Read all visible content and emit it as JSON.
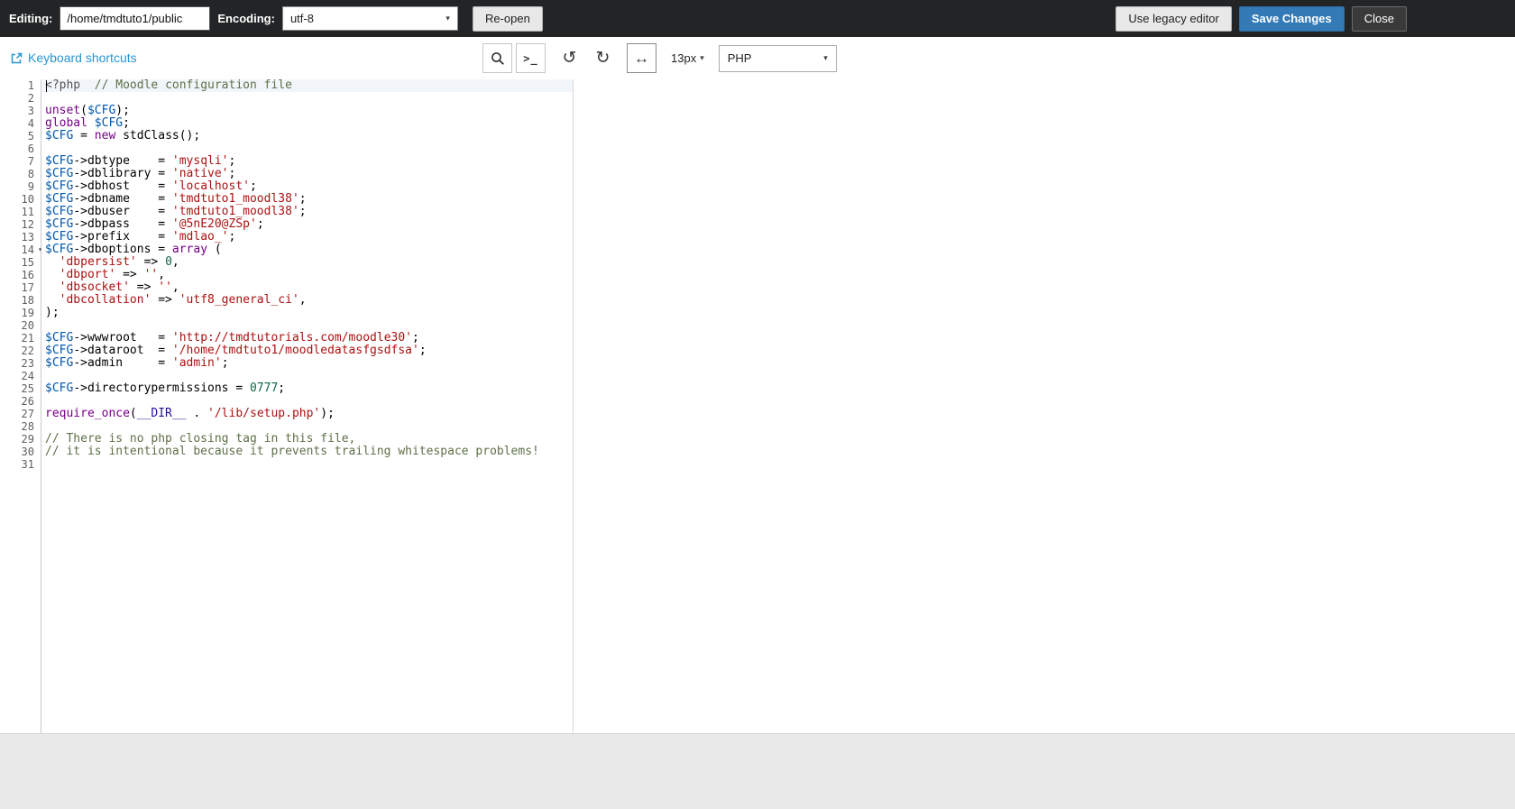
{
  "topbar": {
    "editing_label": "Editing:",
    "file_path": "/home/tmdtuto1/public",
    "encoding_label": "Encoding:",
    "encoding_value": "utf-8",
    "reopen_label": "Re-open",
    "legacy_editor_label": "Use legacy editor",
    "save_changes_label": "Save Changes",
    "close_label": "Close"
  },
  "toolbar": {
    "keyboard_shortcuts_label": "Keyboard shortcuts",
    "font_size_value": "13px",
    "language_value": "PHP"
  },
  "icons": {
    "external_link": "box-with-arrow",
    "search": "magnifier",
    "terminal_prompt": ">_",
    "undo": "↺",
    "redo": "↻",
    "word_wrap": "↔",
    "dropdown_arrow": "▾",
    "fold_arrow": "▾"
  },
  "editor": {
    "active_line": 1,
    "fold_line": 14,
    "line_count": 31,
    "lines": [
      [
        [
          "m",
          "<?php"
        ],
        [
          "p",
          "  "
        ],
        [
          "c",
          "// Moodle configuration file"
        ]
      ],
      [],
      [
        [
          "k",
          "unset"
        ],
        [
          "p",
          "("
        ],
        [
          "v",
          "$CFG"
        ],
        [
          "p",
          ");"
        ]
      ],
      [
        [
          "k",
          "global"
        ],
        [
          "p",
          " "
        ],
        [
          "v",
          "$CFG"
        ],
        [
          "p",
          ";"
        ]
      ],
      [
        [
          "v",
          "$CFG"
        ],
        [
          "p",
          " = "
        ],
        [
          "k",
          "new"
        ],
        [
          "p",
          " stdClass();"
        ]
      ],
      [],
      [
        [
          "v",
          "$CFG"
        ],
        [
          "p",
          "->dbtype    = "
        ],
        [
          "s",
          "'mysqli'"
        ],
        [
          "p",
          ";"
        ]
      ],
      [
        [
          "v",
          "$CFG"
        ],
        [
          "p",
          "->dblibrary = "
        ],
        [
          "s",
          "'native'"
        ],
        [
          "p",
          ";"
        ]
      ],
      [
        [
          "v",
          "$CFG"
        ],
        [
          "p",
          "->dbhost    = "
        ],
        [
          "s",
          "'localhost'"
        ],
        [
          "p",
          ";"
        ]
      ],
      [
        [
          "v",
          "$CFG"
        ],
        [
          "p",
          "->dbname    = "
        ],
        [
          "s",
          "'tmdtuto1_moodl38'"
        ],
        [
          "p",
          ";"
        ]
      ],
      [
        [
          "v",
          "$CFG"
        ],
        [
          "p",
          "->dbuser    = "
        ],
        [
          "s",
          "'tmdtuto1_moodl38'"
        ],
        [
          "p",
          ";"
        ]
      ],
      [
        [
          "v",
          "$CFG"
        ],
        [
          "p",
          "->dbpass    = "
        ],
        [
          "s",
          "'@5nE20@ZSp'"
        ],
        [
          "p",
          ";"
        ]
      ],
      [
        [
          "v",
          "$CFG"
        ],
        [
          "p",
          "->prefix    = "
        ],
        [
          "s",
          "'mdlao_'"
        ],
        [
          "p",
          ";"
        ]
      ],
      [
        [
          "v",
          "$CFG"
        ],
        [
          "p",
          "->dboptions = "
        ],
        [
          "k",
          "array"
        ],
        [
          "p",
          " ("
        ]
      ],
      [
        [
          "p",
          "  "
        ],
        [
          "s",
          "'dbpersist'"
        ],
        [
          "p",
          " => "
        ],
        [
          "n",
          "0"
        ],
        [
          "p",
          ","
        ]
      ],
      [
        [
          "p",
          "  "
        ],
        [
          "s",
          "'dbport'"
        ],
        [
          "p",
          " => "
        ],
        [
          "s",
          "''"
        ],
        [
          "p",
          ","
        ]
      ],
      [
        [
          "p",
          "  "
        ],
        [
          "s",
          "'dbsocket'"
        ],
        [
          "p",
          " => "
        ],
        [
          "s",
          "''"
        ],
        [
          "p",
          ","
        ]
      ],
      [
        [
          "p",
          "  "
        ],
        [
          "s",
          "'dbcollation'"
        ],
        [
          "p",
          " => "
        ],
        [
          "s",
          "'utf8_general_ci'"
        ],
        [
          "p",
          ","
        ]
      ],
      [
        [
          "p",
          ");"
        ]
      ],
      [],
      [
        [
          "v",
          "$CFG"
        ],
        [
          "p",
          "->wwwroot   = "
        ],
        [
          "s",
          "'http://tmdtutorials.com/moodle30'"
        ],
        [
          "p",
          ";"
        ]
      ],
      [
        [
          "v",
          "$CFG"
        ],
        [
          "p",
          "->dataroot  = "
        ],
        [
          "s",
          "'/home/tmdtuto1/moodledatasfgsdfsa'"
        ],
        [
          "p",
          ";"
        ]
      ],
      [
        [
          "v",
          "$CFG"
        ],
        [
          "p",
          "->admin     = "
        ],
        [
          "s",
          "'admin'"
        ],
        [
          "p",
          ";"
        ]
      ],
      [],
      [
        [
          "v",
          "$CFG"
        ],
        [
          "p",
          "->directorypermissions = "
        ],
        [
          "n",
          "0777"
        ],
        [
          "p",
          ";"
        ]
      ],
      [],
      [
        [
          "k",
          "require_once"
        ],
        [
          "p",
          "("
        ],
        [
          "a",
          "__DIR__"
        ],
        [
          "p",
          " . "
        ],
        [
          "s",
          "'/lib/setup.php'"
        ],
        [
          "p",
          ");"
        ]
      ],
      [],
      [
        [
          "c",
          "// There is no php closing tag in this file,"
        ]
      ],
      [
        [
          "c",
          "// it is intentional because it prevents trailing whitespace problems!"
        ]
      ],
      []
    ]
  },
  "colors": {
    "topbar_bg": "#222426",
    "link_blue": "#2795d4",
    "save_button_blue": "#337ab7",
    "syntax": {
      "meta": "#555555",
      "comment": "#5d7048",
      "keyword": "#770088",
      "variable": "#0055aa",
      "string": "#aa1111",
      "number": "#116644",
      "atom": "#221199",
      "plain": "#000000"
    }
  }
}
